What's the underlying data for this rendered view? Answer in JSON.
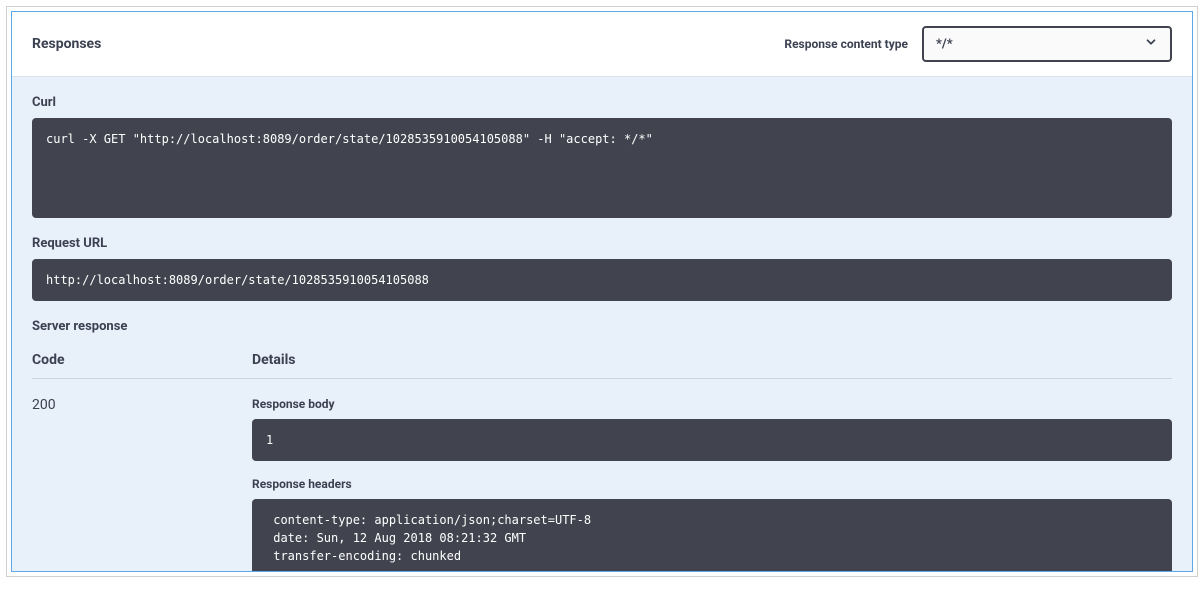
{
  "header": {
    "title": "Responses",
    "content_type_label": "Response content type",
    "content_type_value": "*/*"
  },
  "curl": {
    "label": "Curl",
    "command": "curl -X GET \"http://localhost:8089/order/state/1028535910054105088\" -H \"accept: */*\""
  },
  "request_url": {
    "label": "Request URL",
    "value": "http://localhost:8089/order/state/1028535910054105088"
  },
  "server_response": {
    "label": "Server response",
    "columns": {
      "code": "Code",
      "details": "Details"
    },
    "code": "200",
    "body_label": "Response body",
    "body": "1",
    "headers_label": "Response headers",
    "headers": " content-type: application/json;charset=UTF-8 \n date: Sun, 12 Aug 2018 08:21:32 GMT \n transfer-encoding: chunked "
  }
}
